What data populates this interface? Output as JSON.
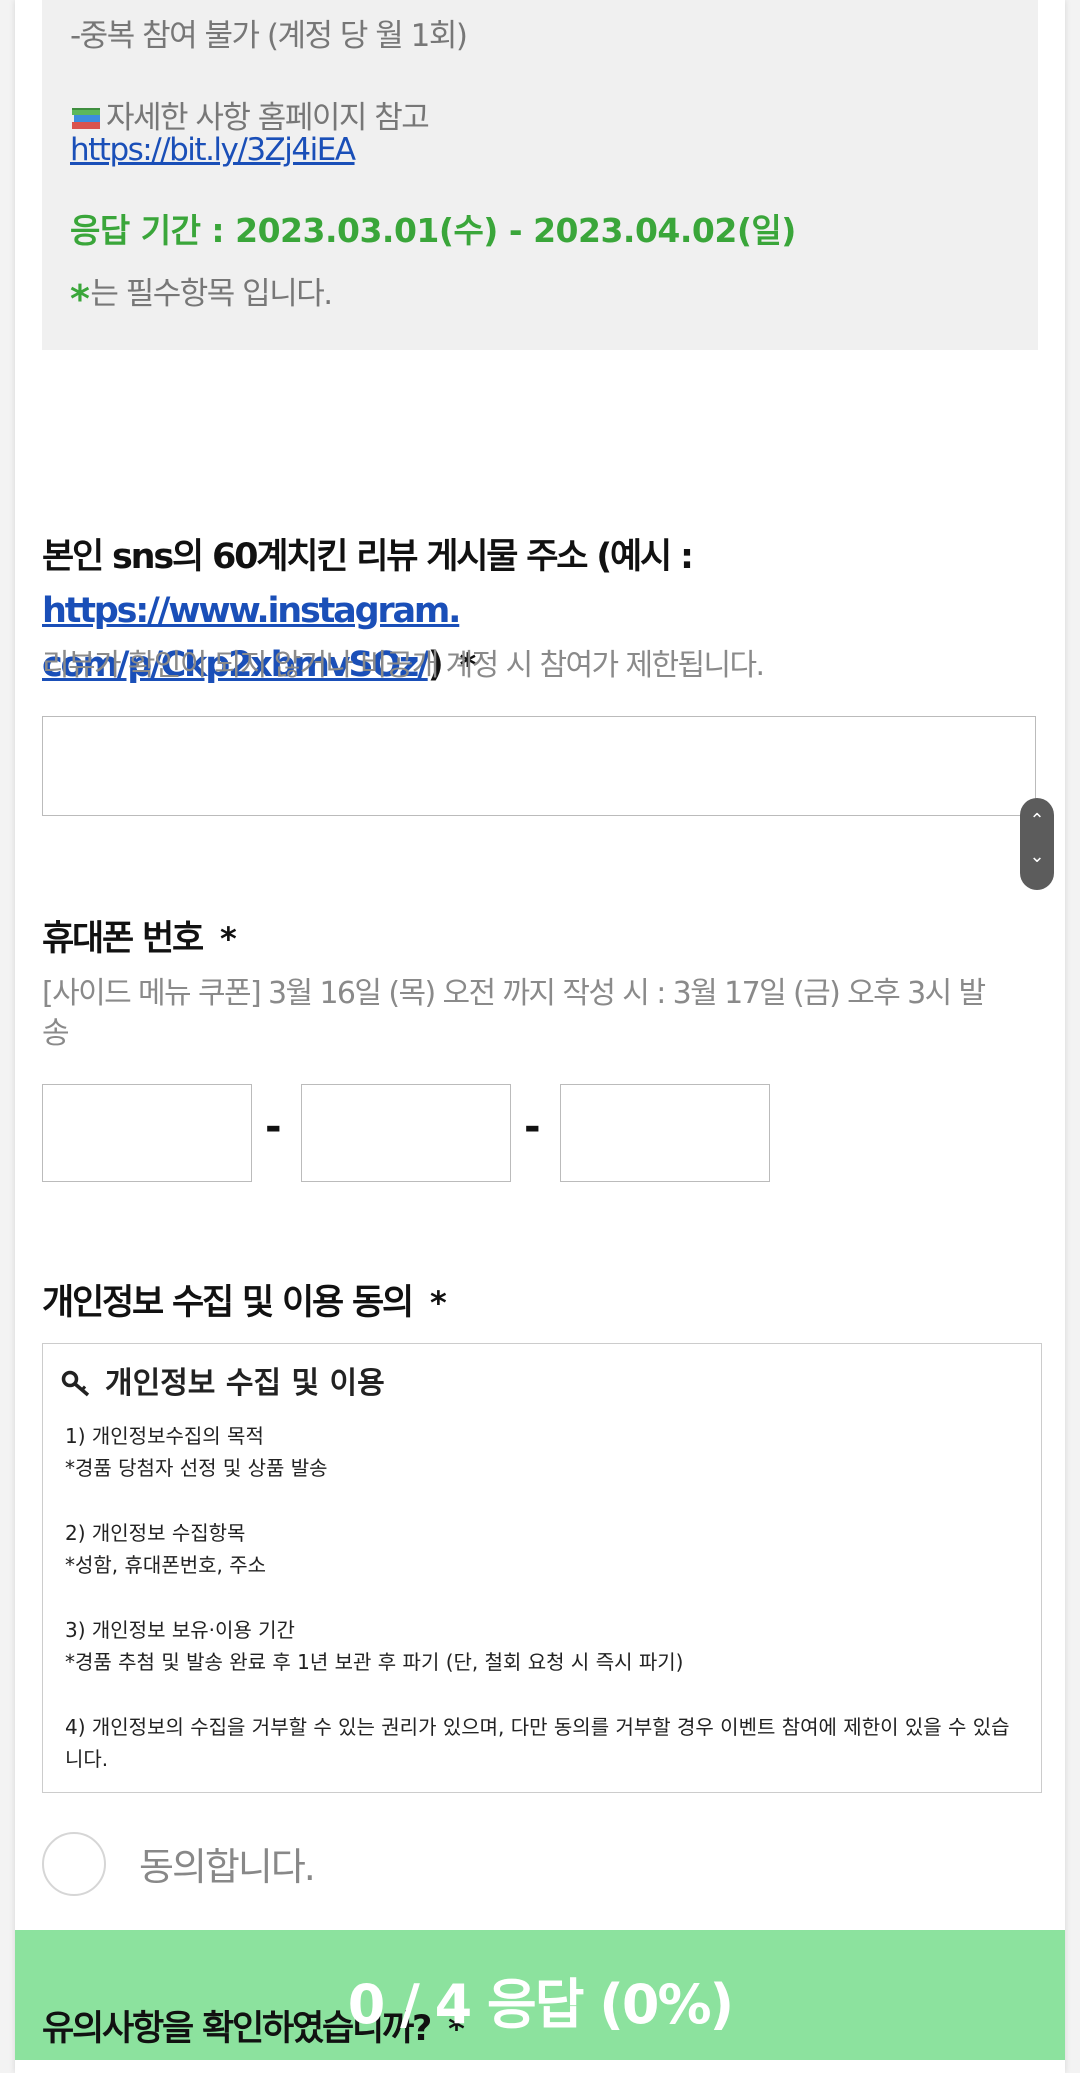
{
  "notice": {
    "duplicate_rule": "-중복 참여 불가 (계정 당 월 1회)",
    "detail_text": "자세한 사항 홈페이지 참고",
    "detail_link": "https://bit.ly/3Zj4iEA",
    "period": "응답 기간 : 2023.03.01(수) - 2023.04.02(일)",
    "required_star": "*",
    "required_text": "는 필수항목 입니다."
  },
  "q1": {
    "title_prefix": "본인 sns의 60계치킨 리뷰 게시물 주소 (예시 : ",
    "title_link_part1": "https://www.instagram.",
    "title_link_part2": "com/p/Ckp2xbmvSOz/",
    "title_suffix": ")",
    "star": "*",
    "description": "리뷰가 확인이 되지 않거나 비공개 계정 시 참여가 제한됩니다.",
    "value": ""
  },
  "scroll": {
    "up": "⌃",
    "down": "⌄"
  },
  "q2": {
    "title": "휴대폰 번호",
    "star": "*",
    "description_line1": "[사이드 메뉴 쿠폰] 3월 16일 (목) 오전 까지 작성 시 : 3월 17일 (금) 오후 3시 발",
    "description_line2": "송",
    "separator": "-",
    "part1": "",
    "part2": "",
    "part3": ""
  },
  "q3": {
    "title": "개인정보 수집 및 이용 동의",
    "star": "*",
    "box_title": "개인정보 수집 및 이용",
    "items": [
      "1) 개인정보수집의 목적",
      "*경품 당첨자 선정 및 상품 발송",
      "2) 개인정보 수집항목",
      "*성함, 휴대폰번호, 주소",
      "3) 개인정보 보유·이용 기간",
      "*경품 추첨 및 발송 완료 후 1년 보관 후 파기 (단, 철회 요청 시 즉시 파기)",
      "4) 개인정보의 수집을 거부할 수 있는 권리가 있으며, 다만 동의를 거부할 경우 이벤트 참여에 제한이 있을 수 있습니다."
    ],
    "agree_label": "동의합니다."
  },
  "q4": {
    "title": "유의사항을 확인하였습니까?",
    "star": "*"
  },
  "progress": {
    "text": "0 / 4 응답 (0%)",
    "answered": 0,
    "total": 4,
    "percent": 0
  },
  "colors": {
    "accent_green": "#3aa63a",
    "progress_green": "#8ce29e",
    "link_blue": "#1a4fb8"
  }
}
